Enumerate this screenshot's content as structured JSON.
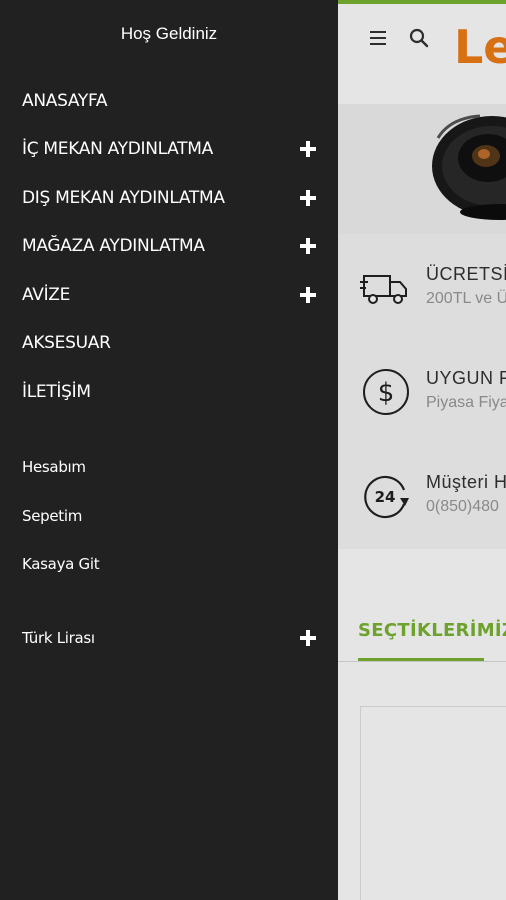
{
  "drawer": {
    "welcome": "Hoş Geldiniz",
    "main_menu": [
      {
        "label": "ANASAYFA",
        "expandable": false
      },
      {
        "label": "İÇ MEKAN AYDINLATMA",
        "expandable": true
      },
      {
        "label": "DIŞ MEKAN AYDINLATMA",
        "expandable": true
      },
      {
        "label": "MAĞAZA AYDINLATMA",
        "expandable": true
      },
      {
        "label": "AVİZE",
        "expandable": true
      },
      {
        "label": "AKSESUAR",
        "expandable": false
      },
      {
        "label": "İLETİŞİM",
        "expandable": false
      }
    ],
    "account_menu": [
      {
        "label": "Hesabım"
      },
      {
        "label": "Sepetim"
      },
      {
        "label": "Kasaya Git"
      }
    ],
    "currency": {
      "label": "Türk Lirası",
      "expandable": true
    }
  },
  "page": {
    "logo_text": "Le",
    "features": [
      {
        "title": "ÜCRETSİZ",
        "subtitle": "200TL ve Ü",
        "icon": "truck-icon"
      },
      {
        "title": "UYGUN F",
        "subtitle": "Piyasa Fiya",
        "icon": "dollar-icon"
      },
      {
        "title": "Müşteri H",
        "subtitle": "0(850)480",
        "icon": "24-hours-icon"
      }
    ],
    "tab_label": "SEÇTİKLERİMİZ"
  },
  "colors": {
    "drawer_bg": "#212121",
    "accent_green": "#7ab532",
    "logo_orange": "#f07d16"
  }
}
